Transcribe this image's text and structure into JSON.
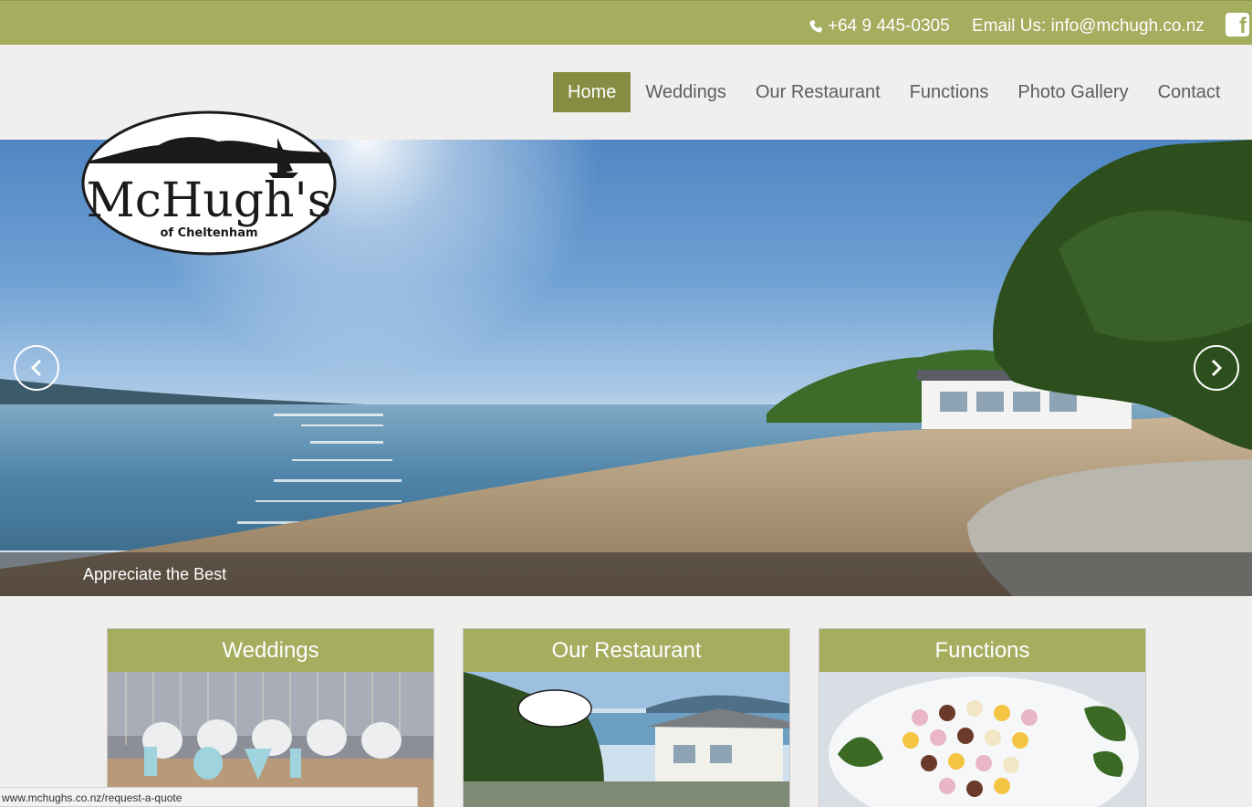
{
  "topbar": {
    "phone": "+64 9 445-0305",
    "email": "Email Us: info@mchugh.co.nz",
    "facebook_icon": "facebook-icon",
    "bg_color": "#a5ad5f"
  },
  "nav": {
    "items": [
      {
        "label": "Home",
        "active": true
      },
      {
        "label": "Weddings"
      },
      {
        "label": "Our Restaurant"
      },
      {
        "label": "Functions"
      },
      {
        "label": "Photo Gallery"
      },
      {
        "label": "Contact"
      }
    ],
    "active_color": "#858d42"
  },
  "logo": {
    "name": "McHugh's",
    "sub": "of Cheltenham"
  },
  "hero": {
    "caption": "Appreciate the Best",
    "prev_icon": "chevron-left-icon",
    "next_icon": "chevron-right-icon"
  },
  "cards": [
    {
      "title": "Weddings"
    },
    {
      "title": "Our Restaurant"
    },
    {
      "title": "Functions"
    }
  ],
  "status_bar": {
    "url": "www.mchughs.co.nz/request-a-quote"
  }
}
